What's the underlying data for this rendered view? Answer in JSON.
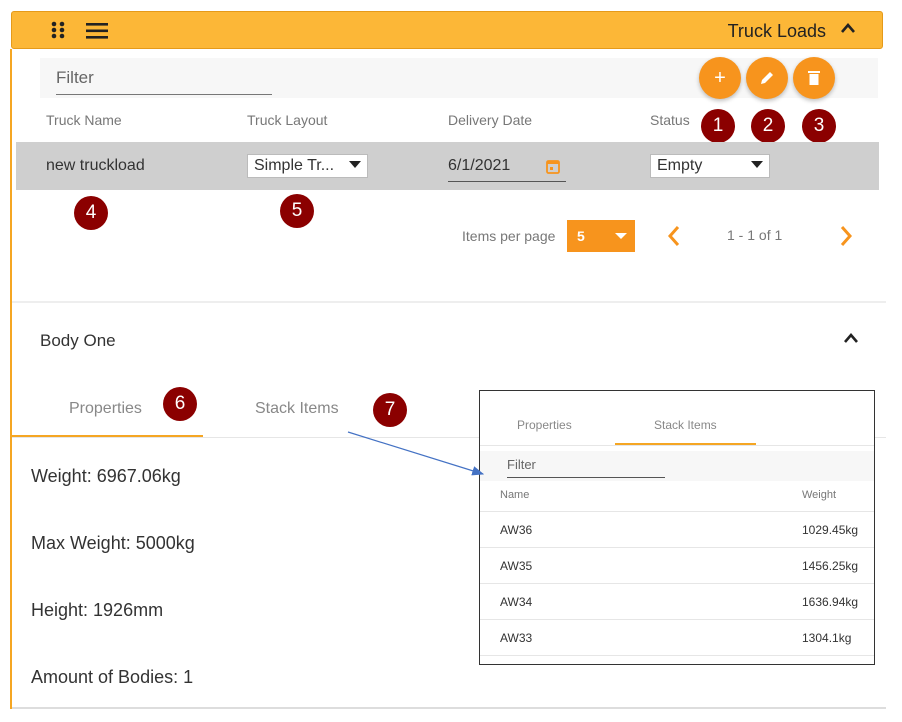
{
  "header": {
    "title": "Truck Loads",
    "drag_icon": "drag-grid-icon",
    "menu_icon": "hamburger-menu-icon",
    "collapse_icon": "chevron-up-icon"
  },
  "filter": {
    "placeholder": "Filter"
  },
  "actions": {
    "add": "+",
    "edit_icon": "pencil-icon",
    "delete_icon": "trash-icon"
  },
  "markers": [
    "1",
    "2",
    "3",
    "4",
    "5",
    "6",
    "7"
  ],
  "table": {
    "columns": [
      "Truck Name",
      "Truck Layout",
      "Delivery Date",
      "Status"
    ],
    "row": {
      "name": "new truckload",
      "layout": "Simple Tr...",
      "date": "6/1/2021",
      "status": "Empty"
    }
  },
  "pagination": {
    "items_per_page_label": "Items per page",
    "items_per_page": "5",
    "range": "1 - 1 of 1"
  },
  "body": {
    "title": "Body One",
    "tabs": [
      "Properties",
      "Stack Items"
    ],
    "properties": [
      "Weight: 6967.06kg",
      "Max Weight: 5000kg",
      "Height: 1926mm",
      "Amount of Bodies: 1"
    ]
  },
  "inset": {
    "tabs": [
      "Properties",
      "Stack Items"
    ],
    "filter": "Filter",
    "columns": [
      "Name",
      "Weight"
    ],
    "rows": [
      {
        "name": "AW36",
        "weight": "1029.45kg"
      },
      {
        "name": "AW35",
        "weight": "1456.25kg"
      },
      {
        "name": "AW34",
        "weight": "1636.94kg"
      },
      {
        "name": "AW33",
        "weight": "1304.1kg"
      }
    ]
  },
  "colors": {
    "accent": "#F7941D",
    "header": "#FCB737",
    "marker": "#8B0000"
  }
}
